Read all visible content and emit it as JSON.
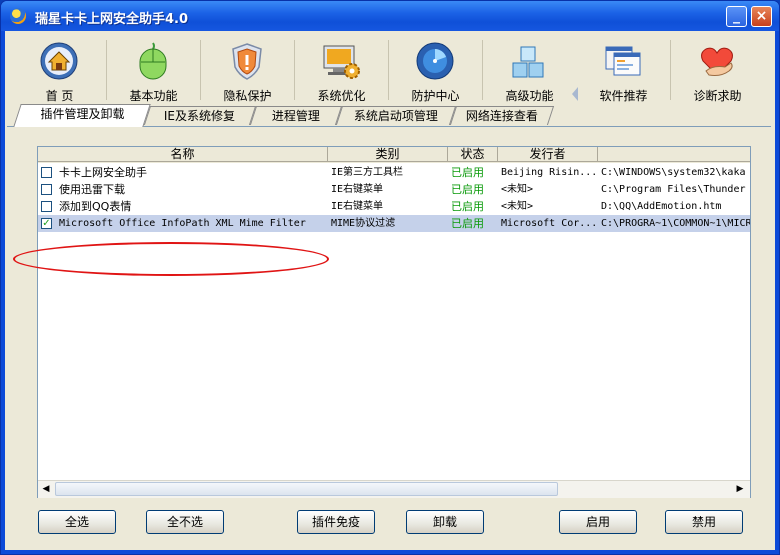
{
  "window": {
    "title": "瑞星卡卡上网安全助手4.0",
    "minimize_label": "_",
    "close_label": "×"
  },
  "toolbar": [
    {
      "label": "首 页",
      "icon": "home-icon"
    },
    {
      "label": "基本功能",
      "icon": "mouse-icon"
    },
    {
      "label": "隐私保护",
      "icon": "shield-icon"
    },
    {
      "label": "系统优化",
      "icon": "monitor-gear-icon"
    },
    {
      "label": "防护中心",
      "icon": "radar-icon"
    },
    {
      "label": "高级功能",
      "icon": "cubes-icon"
    },
    {
      "label": "软件推荐",
      "icon": "windows-icon"
    },
    {
      "label": "诊断求助",
      "icon": "heart-hand-icon"
    }
  ],
  "subtabs": [
    {
      "label": "插件管理及卸载",
      "active": true
    },
    {
      "label": "IE及系统修复",
      "active": false
    },
    {
      "label": "进程管理",
      "active": false
    },
    {
      "label": "系统启动项管理",
      "active": false
    },
    {
      "label": "网络连接查看",
      "active": false
    }
  ],
  "table": {
    "headers": [
      "名称",
      "类别",
      "状态",
      "发行者",
      ""
    ],
    "rows": [
      {
        "checked": false,
        "name": "卡卡上网安全助手",
        "category": "IE第三方工具栏",
        "status": "已启用",
        "publisher": "Beijing Risin...",
        "path": "C:\\WINDOWS\\system32\\kaka"
      },
      {
        "checked": false,
        "name": "使用迅雷下载",
        "category": "IE右键菜单",
        "status": "已启用",
        "publisher": "<未知>",
        "path": "C:\\Program Files\\Thunder"
      },
      {
        "checked": false,
        "name": "添加到QQ表情",
        "category": "IE右键菜单",
        "status": "已启用",
        "publisher": "<未知>",
        "path": "D:\\QQ\\AddEmotion.htm"
      },
      {
        "checked": true,
        "name": "Microsoft Office InfoPath XML Mime Filter",
        "category": "MIME协议过滤",
        "status": "已启用",
        "publisher": "Microsoft Cor...",
        "path": "C:\\PROGRA~1\\COMMON~1\\MICR"
      }
    ],
    "check_mark": "✓"
  },
  "scroll": {
    "left_arrow": "◀",
    "right_arrow": "▶"
  },
  "buttons": {
    "select_all": "全选",
    "select_none": "全不选",
    "plugin_immune": "插件免疫",
    "uninstall": "卸载",
    "enable": "启用",
    "disable": "禁用"
  },
  "colors": {
    "status_enabled": "#0a9a0a",
    "selection": "#c5d1ea",
    "annotation": "#e01414"
  }
}
